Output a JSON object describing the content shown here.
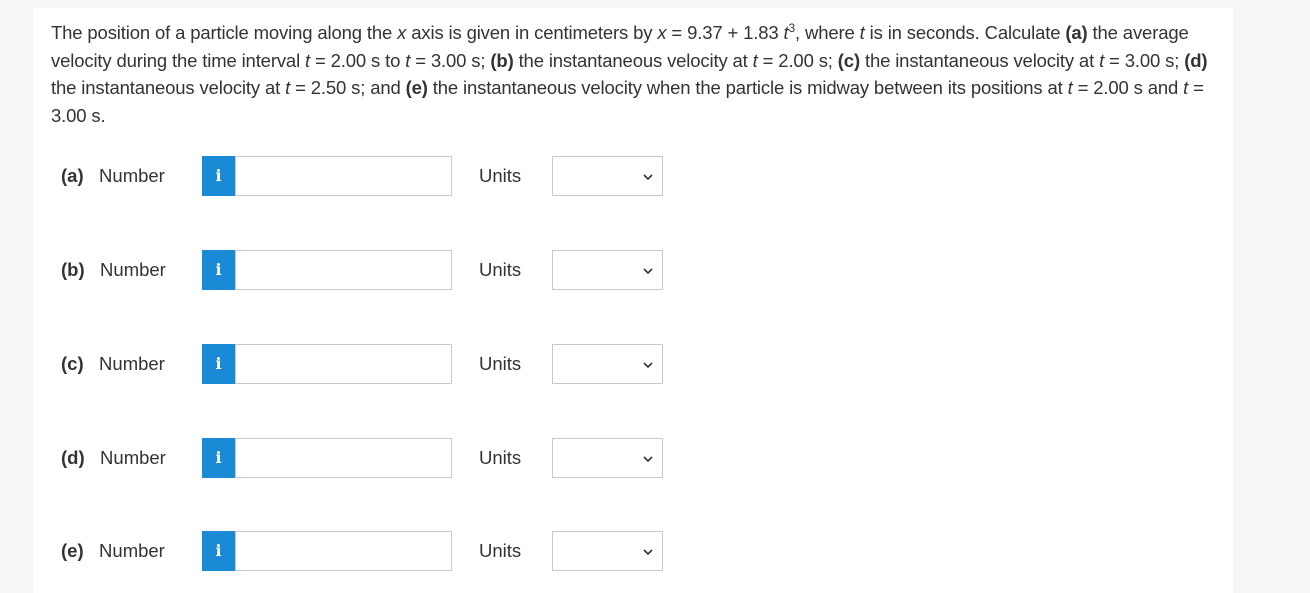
{
  "question": {
    "intro": "The position of a particle moving along the ",
    "x1": "x",
    "t_axis_text": " axis is given in centimeters by ",
    "x2": "x",
    "eq_mid": " = 9.37 + 1.83 ",
    "t1": "t",
    "exp": "3",
    "where": ", where ",
    "t2": "t",
    "is_seconds": " is in seconds. Calculate ",
    "a": "(a)",
    "a_text": " the average velocity during the time interval ",
    "t3": "t",
    "a_from": " = 2.00 s to ",
    "t4": "t",
    "a_to": " = 3.00 s; ",
    "b": "(b)",
    "b_text": " the instantaneous velocity at ",
    "t5": "t",
    "b_val": " = 2.00 s; ",
    "c": "(c)",
    "c_text": " the instantaneous velocity at ",
    "t6": "t",
    "c_val": " = 3.00 s; ",
    "d": "(d)",
    "d_text": " the instantaneous velocity at ",
    "t7": "t",
    "d_val": " = 2.50 s; and ",
    "e": "(e)",
    "e_text": " the instantaneous velocity when the particle is midway between its positions at ",
    "t8": "t",
    "e_mid": " = 2.00 s and ",
    "t9": "t",
    "e_end": " = 3.00 s."
  },
  "parts": [
    {
      "letter": "(a)",
      "number_label": "Number",
      "info_icon": "i",
      "value": "",
      "units_label": "Units",
      "units_selected": ""
    },
    {
      "letter": "(b)",
      "number_label": "Number",
      "info_icon": "i",
      "value": "",
      "units_label": "Units",
      "units_selected": ""
    },
    {
      "letter": "(c)",
      "number_label": "Number",
      "info_icon": "i",
      "value": "",
      "units_label": "Units",
      "units_selected": ""
    },
    {
      "letter": "(d)",
      "number_label": "Number",
      "info_icon": "i",
      "value": "",
      "units_label": "Units",
      "units_selected": ""
    },
    {
      "letter": "(e)",
      "number_label": "Number",
      "info_icon": "i",
      "value": "",
      "units_label": "Units",
      "units_selected": ""
    }
  ],
  "colors": {
    "info_button": "#1b8ad6",
    "panel": "#ffffff",
    "page": "#f6f6f6"
  },
  "icons": {
    "info": "info-icon",
    "dropdown": "chevron-down-icon"
  }
}
